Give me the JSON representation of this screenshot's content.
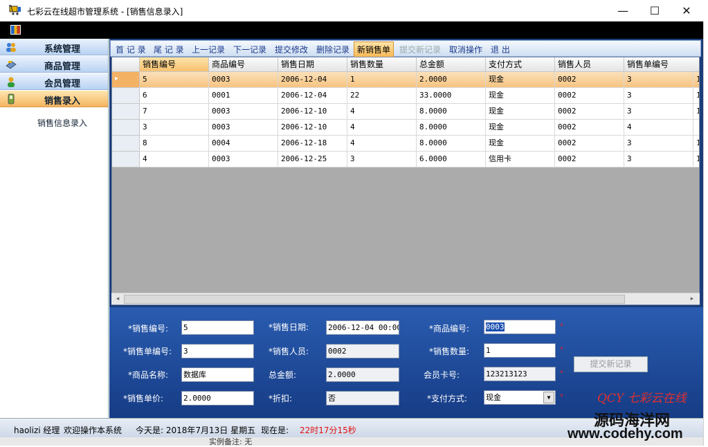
{
  "window": {
    "title": "七彩云在线超市管理系统 - [销售信息录入]",
    "controls": {
      "minimize": "—",
      "maximize": "☐",
      "close": "✕"
    }
  },
  "sidebar": {
    "sections": [
      {
        "label": "系统管理",
        "icon": "users-icon",
        "active": false
      },
      {
        "label": "商品管理",
        "icon": "goods-icon",
        "active": false
      },
      {
        "label": "会员管理",
        "icon": "member-icon",
        "active": false
      },
      {
        "label": "销售录入",
        "icon": "sales-icon",
        "active": true
      }
    ],
    "sub_item": "销售信息录入"
  },
  "toolbar": {
    "items": [
      {
        "label": "首 记 录",
        "state": "normal"
      },
      {
        "label": "尾 记 录",
        "state": "normal"
      },
      {
        "label": "上一记录",
        "state": "normal"
      },
      {
        "label": "下一记录",
        "state": "normal"
      },
      {
        "label": "提交修改",
        "state": "normal"
      },
      {
        "label": "删除记录",
        "state": "normal"
      },
      {
        "label": "新销售单",
        "state": "hot"
      },
      {
        "label": "提交新记录",
        "state": "disabled"
      },
      {
        "label": "取消操作",
        "state": "normal"
      },
      {
        "label": "退 出",
        "state": "normal"
      }
    ]
  },
  "grid": {
    "columns": [
      "销售编号",
      "商品编号",
      "销售日期",
      "销售数量",
      "总金额",
      "支付方式",
      "销售人员",
      "销售单编号"
    ],
    "rows": [
      [
        "5",
        "0003",
        "2006-12-04",
        "1",
        "2.0000",
        "现金",
        "0002",
        "3",
        "1"
      ],
      [
        "6",
        "0001",
        "2006-12-04",
        "22",
        "33.0000",
        "现金",
        "0002",
        "3",
        "1"
      ],
      [
        "7",
        "0003",
        "2006-12-10",
        "4",
        "8.0000",
        "现金",
        "0002",
        "3",
        "1"
      ],
      [
        "3",
        "0003",
        "2006-12-10",
        "4",
        "8.0000",
        "现金",
        "0002",
        "4",
        ""
      ],
      [
        "8",
        "0004",
        "2006-12-18",
        "4",
        "8.0000",
        "现金",
        "0002",
        "3",
        "1"
      ],
      [
        "4",
        "0003",
        "2006-12-25",
        "3",
        "6.0000",
        "信用卡",
        "0002",
        "3",
        "1"
      ]
    ],
    "selected_row": 0,
    "row_pointer": "▸",
    "scroll_left": "◂",
    "scroll_right": "▸"
  },
  "form": {
    "sale_id": {
      "label": "*销售编号:",
      "value": "5"
    },
    "sale_date": {
      "label": "*销售日期:",
      "value": "2006-12-04 00:00:"
    },
    "product_id": {
      "label": "*商品编号:",
      "value": "0003"
    },
    "order_id": {
      "label": "*销售单编号:",
      "value": "3"
    },
    "salesperson": {
      "label": "*销售人员:",
      "value": "0002"
    },
    "quantity": {
      "label": "*销售数量:",
      "value": "1"
    },
    "product_name": {
      "label": "*商品名称:",
      "value": "数据库"
    },
    "total": {
      "label": "总金额:",
      "value": "2.0000"
    },
    "member_card": {
      "label": "会员卡号:",
      "value": "123213123"
    },
    "unit_price": {
      "label": "*销售单价:",
      "value": "2.0000"
    },
    "discount": {
      "label": "*折扣:",
      "value": "否"
    },
    "payment": {
      "label": "*支付方式:",
      "value": "现金"
    },
    "required_mark": "*",
    "submit_label": "提交新记录",
    "logo_text": "QCY 七彩云在线"
  },
  "status": {
    "user": "haolizi 经理",
    "welcome": "欢迎操作本系统",
    "today": "今天是: 2018年7月13日 星期五",
    "now_label": "现在是:",
    "time": "22时17分15秒",
    "under_text": "实例备注: 无"
  },
  "watermark": {
    "line1": "源码海洋网",
    "line2": "www.codehy.com"
  }
}
